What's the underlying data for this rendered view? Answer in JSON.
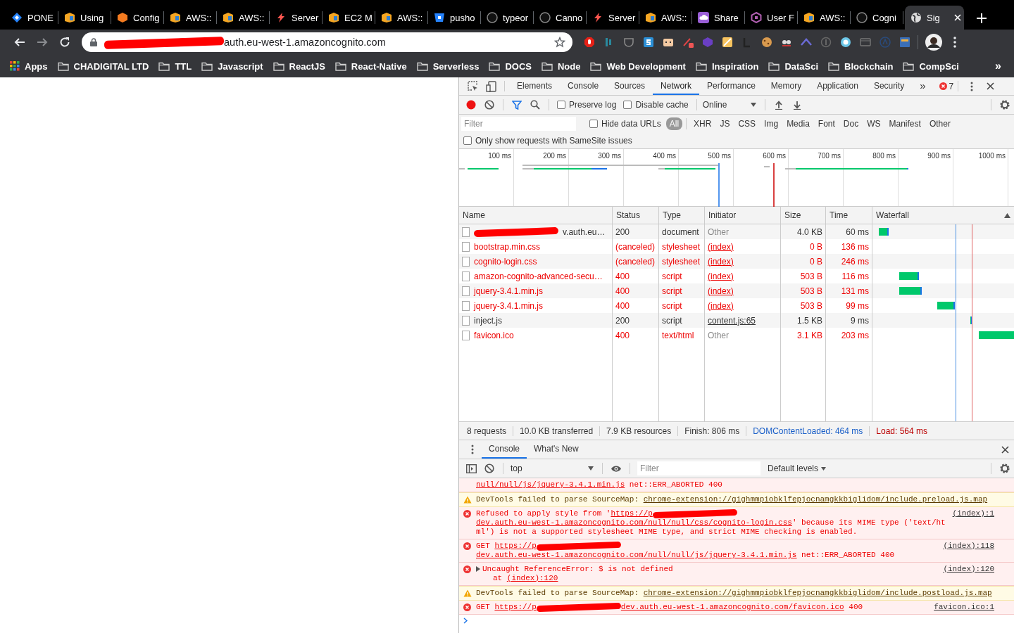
{
  "browser": {
    "tabs": [
      {
        "title": "PONE",
        "kind": "diamond",
        "selected": false
      },
      {
        "title": "Using",
        "kind": "aws-box",
        "selected": false
      },
      {
        "title": "Config",
        "kind": "cube",
        "selected": false
      },
      {
        "title": "AWS::",
        "kind": "aws-box",
        "selected": false
      },
      {
        "title": "AWS::",
        "kind": "aws-box",
        "selected": false
      },
      {
        "title": "Server",
        "kind": "bolt",
        "selected": false
      },
      {
        "title": "EC2 M",
        "kind": "aws-box",
        "selected": false
      },
      {
        "title": "AWS::",
        "kind": "aws-box",
        "selected": false
      },
      {
        "title": "pusho",
        "kind": "bucket",
        "selected": false
      },
      {
        "title": "typeor",
        "kind": "github",
        "selected": false
      },
      {
        "title": "Canno",
        "kind": "github",
        "selected": false
      },
      {
        "title": "Server",
        "kind": "bolt",
        "selected": false
      },
      {
        "title": "AWS::",
        "kind": "aws-box",
        "selected": false
      },
      {
        "title": "Share",
        "kind": "share",
        "selected": false
      },
      {
        "title": "User F",
        "kind": "userpool",
        "selected": false
      },
      {
        "title": "AWS::",
        "kind": "aws-box",
        "selected": false
      },
      {
        "title": "Cogni",
        "kind": "github",
        "selected": false
      },
      {
        "title": "Sig",
        "kind": "globe",
        "selected": true
      }
    ],
    "address": {
      "redacted": true,
      "text": "auth.eu-west-1.amazoncognito.com"
    },
    "bookmarks": [
      {
        "label": "Apps",
        "kind": "apps"
      },
      {
        "label": "CHADIGITAL LTD",
        "kind": "folder"
      },
      {
        "label": "TTL",
        "kind": "folder"
      },
      {
        "label": "Javascript",
        "kind": "folder"
      },
      {
        "label": "ReactJS",
        "kind": "folder"
      },
      {
        "label": "React-Native",
        "kind": "folder"
      },
      {
        "label": "Serverless",
        "kind": "folder"
      },
      {
        "label": "DOCS",
        "kind": "folder"
      },
      {
        "label": "Node",
        "kind": "folder"
      },
      {
        "label": "Web Development",
        "kind": "folder"
      },
      {
        "label": "Inspiration",
        "kind": "folder"
      },
      {
        "label": "DataSci",
        "kind": "folder"
      },
      {
        "label": "Blockchain",
        "kind": "folder"
      },
      {
        "label": "CompSci",
        "kind": "folder"
      }
    ],
    "bookmarks_more": "»"
  },
  "devtools": {
    "panel_tabs": [
      {
        "label": "Elements",
        "selected": false
      },
      {
        "label": "Console",
        "selected": false
      },
      {
        "label": "Sources",
        "selected": false
      },
      {
        "label": "Network",
        "selected": true
      },
      {
        "label": "Performance",
        "selected": false
      },
      {
        "label": "Memory",
        "selected": false
      },
      {
        "label": "Application",
        "selected": false
      },
      {
        "label": "Security",
        "selected": false
      }
    ],
    "overflow": "»",
    "error_count": "7",
    "network": {
      "recording": true,
      "filter_active": true,
      "preserve_log": false,
      "preserve_log_label": "Preserve log",
      "disable_cache": false,
      "disable_cache_label": "Disable cache",
      "throttling": "Online",
      "filter_placeholder": "Filter",
      "hide_data_urls": false,
      "hide_data_urls_label": "Hide data URLs",
      "type_filters": [
        {
          "label": "All",
          "selected": true
        },
        {
          "label": "XHR",
          "selected": false
        },
        {
          "label": "JS",
          "selected": false
        },
        {
          "label": "CSS",
          "selected": false
        },
        {
          "label": "Img",
          "selected": false
        },
        {
          "label": "Media",
          "selected": false
        },
        {
          "label": "Font",
          "selected": false
        },
        {
          "label": "Doc",
          "selected": false
        },
        {
          "label": "WS",
          "selected": false
        },
        {
          "label": "Manifest",
          "selected": false
        },
        {
          "label": "Other",
          "selected": false
        }
      ],
      "samesite_only": false,
      "samesite_label": "Only show requests with SameSite issues",
      "overview_ticks": [
        "100 ms",
        "200 ms",
        "300 ms",
        "400 ms",
        "500 ms",
        "600 ms",
        "700 ms",
        "800 ms",
        "900 ms",
        "1000 ms"
      ],
      "columns": [
        "Name",
        "Status",
        "Type",
        "Initiator",
        "Size",
        "Time",
        "Waterfall"
      ],
      "requests": [
        {
          "name": "v.auth.eu…",
          "name_redacted": true,
          "status": "200",
          "type": "document",
          "initiator": "Other",
          "initiator_link": false,
          "size": "4.0 KB",
          "time": "60 ms",
          "failed": false
        },
        {
          "name": "bootstrap.min.css",
          "name_redacted": false,
          "status": "(canceled)",
          "type": "stylesheet",
          "initiator": "(index)",
          "initiator_link": true,
          "size": "0 B",
          "time": "136 ms",
          "failed": true
        },
        {
          "name": "cognito-login.css",
          "name_redacted": false,
          "status": "(canceled)",
          "type": "stylesheet",
          "initiator": "(index)",
          "initiator_link": true,
          "size": "0 B",
          "time": "246 ms",
          "failed": true
        },
        {
          "name": "amazon-cognito-advanced-secu…",
          "name_redacted": false,
          "status": "400",
          "type": "script",
          "initiator": "(index)",
          "initiator_link": true,
          "size": "503 B",
          "time": "116 ms",
          "failed": true
        },
        {
          "name": "jquery-3.4.1.min.js",
          "name_redacted": false,
          "status": "400",
          "type": "script",
          "initiator": "(index)",
          "initiator_link": true,
          "size": "503 B",
          "time": "131 ms",
          "failed": true
        },
        {
          "name": "jquery-3.4.1.min.js",
          "name_redacted": false,
          "status": "400",
          "type": "script",
          "initiator": "(index)",
          "initiator_link": true,
          "size": "503 B",
          "time": "99 ms",
          "failed": true
        },
        {
          "name": "inject.js",
          "name_redacted": false,
          "status": "200",
          "type": "script",
          "initiator": "content.js:65",
          "initiator_link": true,
          "size": "1.5 KB",
          "time": "9 ms",
          "failed": false
        },
        {
          "name": "favicon.ico",
          "name_redacted": false,
          "status": "400",
          "type": "text/html",
          "initiator": "Other",
          "initiator_link": false,
          "size": "3.1 KB",
          "time": "203 ms",
          "failed": true
        }
      ],
      "summary": [
        {
          "text": "8 requests",
          "kind": "plain"
        },
        {
          "text": "10.0 KB transferred",
          "kind": "plain"
        },
        {
          "text": "7.9 KB resources",
          "kind": "plain"
        },
        {
          "text": "Finish: 806 ms",
          "kind": "plain"
        },
        {
          "text": "DOMContentLoaded: 464 ms",
          "kind": "dom"
        },
        {
          "text": "Load: 564 ms",
          "kind": "load"
        }
      ]
    },
    "drawer_tabs": [
      {
        "label": "Console",
        "selected": true
      },
      {
        "label": "What's New",
        "selected": false
      }
    ],
    "console": {
      "context": "top",
      "filter_placeholder": "Filter",
      "levels": "Default levels",
      "messages": [
        {
          "kind": "error-continued",
          "parts": [
            {
              "kind": "link",
              "text": "null/null/js/jquery-3.4.1.min.js"
            },
            {
              "kind": "text",
              "text": " net::ERR_ABORTED 400"
            }
          ]
        },
        {
          "kind": "warning",
          "parts": [
            {
              "kind": "text",
              "text": "DevTools failed to parse SourceMap: "
            },
            {
              "kind": "link",
              "text": "chrome-extension://gighmmpiobklfepjocnamgkkbiglidom/include.preload.js.map"
            }
          ]
        },
        {
          "kind": "error",
          "source": "(index):1",
          "parts": [
            {
              "kind": "text",
              "text": "Refused to apply style from '"
            },
            {
              "kind": "link",
              "text": "https://p"
            },
            {
              "kind": "redaction"
            },
            {
              "kind": "link",
              "text": "dev.auth.eu-west-1.amazoncognito.com/null/null/css/cognito-login.css"
            },
            {
              "kind": "text",
              "text": "' because its MIME type ('text/html') is not a supported stylesheet MIME type, and strict MIME checking is enabled."
            }
          ]
        },
        {
          "kind": "error",
          "source": "(index):118",
          "parts": [
            {
              "kind": "text",
              "text": "GET "
            },
            {
              "kind": "link",
              "text": "https://p"
            },
            {
              "kind": "redaction"
            },
            {
              "kind": "link",
              "text": "dev.auth.eu-west-1.amazoncognito.com/null/null/js/jquery-3.4.1.min.js"
            },
            {
              "kind": "text",
              "text": " net::ERR_ABORTED 400"
            }
          ]
        },
        {
          "kind": "error",
          "source": "(index):120",
          "expandable": true,
          "parts": [
            {
              "kind": "text",
              "text": "Uncaught ReferenceError: $ is not defined"
            }
          ],
          "detail": [
            {
              "kind": "text",
              "text": "at "
            },
            {
              "kind": "link",
              "text": "(index):120"
            }
          ]
        },
        {
          "kind": "warning",
          "parts": [
            {
              "kind": "text",
              "text": "DevTools failed to parse SourceMap: "
            },
            {
              "kind": "link",
              "text": "chrome-extension://gighmmpiobklfepjocnamgkkbiglidom/include.postload.js.map"
            }
          ]
        },
        {
          "kind": "error",
          "source": "favicon.ico:1",
          "parts": [
            {
              "kind": "text",
              "text": "GET "
            },
            {
              "kind": "link",
              "text": "https://p"
            },
            {
              "kind": "redaction"
            },
            {
              "kind": "link",
              "text": "dev.auth.eu-west-1.amazoncognito.com/favicon.ico"
            },
            {
              "kind": "text",
              "text": " 400"
            }
          ]
        }
      ]
    }
  }
}
